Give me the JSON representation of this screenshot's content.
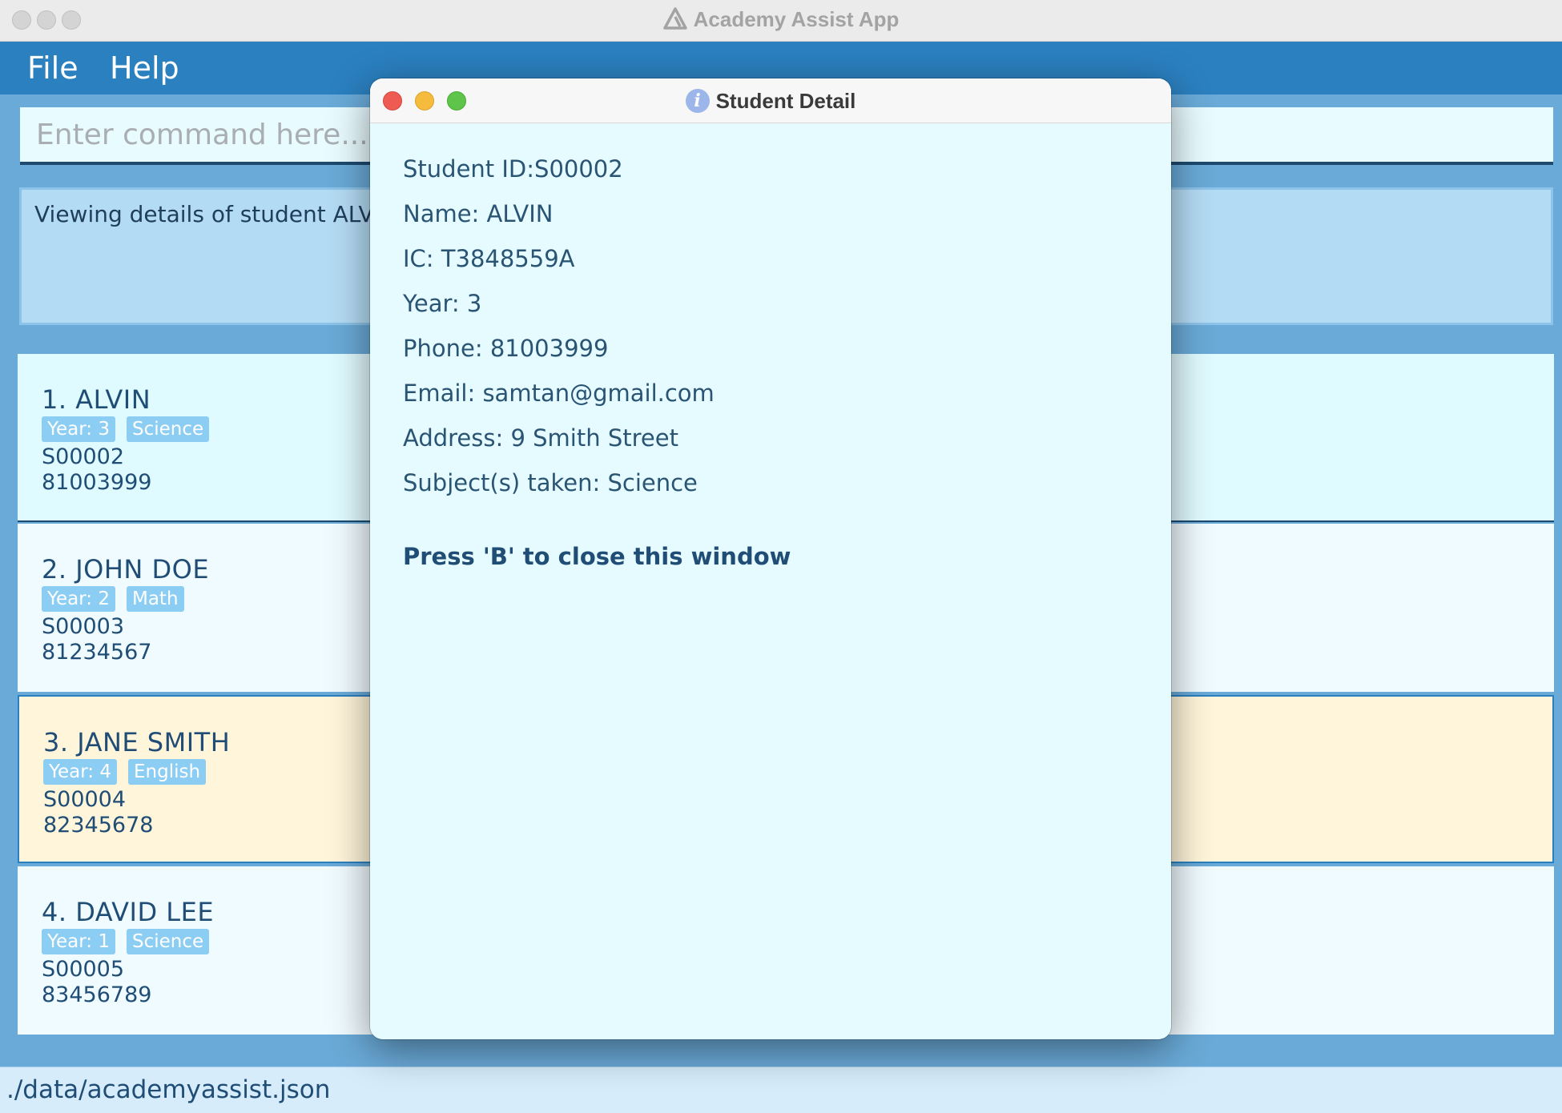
{
  "window": {
    "title": "Academy Assist App"
  },
  "menu": {
    "items": [
      {
        "label": "File"
      },
      {
        "label": "Help"
      }
    ]
  },
  "command": {
    "placeholder": "Enter command here...",
    "value": ""
  },
  "result": {
    "message": "Viewing details of student ALVIN"
  },
  "students": [
    {
      "index_name": "1. ALVIN",
      "tags": [
        "Year: 3",
        "Science"
      ],
      "id": "S00002",
      "phone": "81003999"
    },
    {
      "index_name": "2. JOHN DOE",
      "tags": [
        "Year: 2",
        "Math"
      ],
      "id": "S00003",
      "phone": "81234567"
    },
    {
      "index_name": "3. JANE SMITH",
      "tags": [
        "Year: 4",
        "English"
      ],
      "id": "S00004",
      "phone": "82345678"
    },
    {
      "index_name": "4. DAVID LEE",
      "tags": [
        "Year: 1",
        "Science"
      ],
      "id": "S00005",
      "phone": "83456789"
    }
  ],
  "status": {
    "path": "./data/academyassist.json"
  },
  "dialog": {
    "title": "Student Detail",
    "details": [
      "Student ID:S00002",
      "Name: ALVIN",
      "IC: T3848559A",
      "Year: 3",
      "Phone: 81003999",
      "Email: samtan@gmail.com",
      "Address: 9 Smith Street",
      "Subject(s) taken: Science"
    ],
    "close_hint": "Press 'B' to close this window"
  },
  "colors": {
    "menubar": "#2b80c0",
    "background": "#6aaad8",
    "card_selected": "#fff5da",
    "tag": "#8ccdf3",
    "dialog_bg": "#e5fbff",
    "traffic_close": "#ee5b53",
    "traffic_min": "#f5bb3d",
    "traffic_max": "#5ec54a"
  }
}
